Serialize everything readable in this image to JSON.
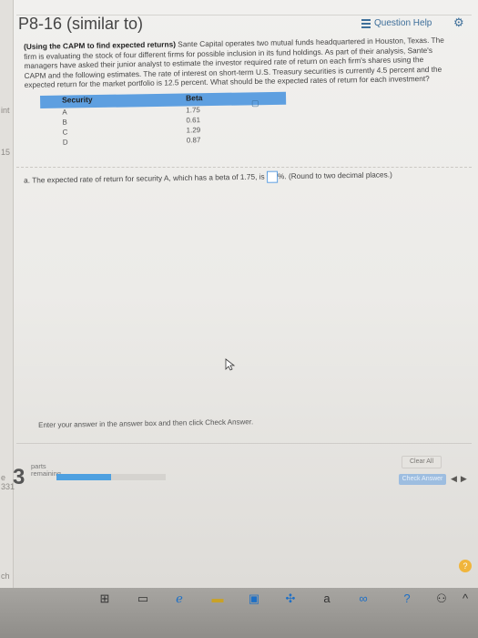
{
  "left_gutter": {
    "labels": [
      "int",
      "15",
      "e 331",
      "ch"
    ],
    "count": "3"
  },
  "header": {
    "title": "P8-16 (similar to)",
    "help_label": "Question Help"
  },
  "problem": {
    "bold_intro": "(Using the CAPM to find expected returns)",
    "text": " Sante Capital operates two mutual funds headquartered in Houston, Texas. The firm is evaluating the stock of four different firms for possible inclusion in its fund holdings. As part of their analysis, Sante's managers have asked their junior analyst to estimate the investor required rate of return on each firm's shares using the CAPM and the following estimates. The rate of interest on short-term U.S. Treasury securities is currently 4.5 percent and the expected return for the market portfolio is 12.5 percent. What should be the expected rates of return for each investment?"
  },
  "table": {
    "headers": [
      "Security",
      "Beta"
    ],
    "rows": [
      {
        "security": "A",
        "beta": "1.75"
      },
      {
        "security": "B",
        "beta": "0.61"
      },
      {
        "security": "C",
        "beta": "1.29"
      },
      {
        "security": "D",
        "beta": "0.87"
      }
    ]
  },
  "question": {
    "prefix": "a. The expected rate of return for security A, which has a beta of 1.75, is",
    "suffix": "%. (Round to two decimal places.)"
  },
  "footer": {
    "instructions": "Enter your answer in the answer box and then click Check Answer.",
    "parts_line1": "parts",
    "parts_line2": "remaining",
    "progress": 0.5,
    "clear_all": "Clear All",
    "check_answer": "Check Answer"
  },
  "icons": {
    "help_circle": "?"
  }
}
